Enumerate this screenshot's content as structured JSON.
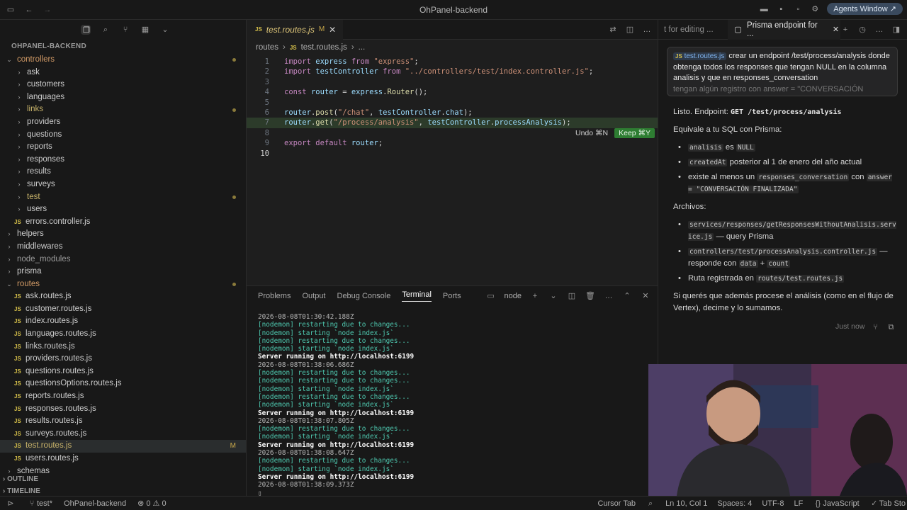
{
  "window": {
    "title": "OhPanel-backend",
    "agents_button": "Agents Window ↗"
  },
  "sidebar": {
    "explorer_title": "OHPANEL-BACKEND",
    "tree": [
      {
        "label": "controllers",
        "type": "folder",
        "open": true,
        "indent": 1,
        "color": "orange",
        "dot": true
      },
      {
        "label": "ask",
        "type": "folder",
        "indent": 2
      },
      {
        "label": "customers",
        "type": "folder",
        "indent": 2
      },
      {
        "label": "languages",
        "type": "folder",
        "indent": 2
      },
      {
        "label": "links",
        "type": "folder",
        "indent": 2,
        "color": "yellowish",
        "dot": true
      },
      {
        "label": "providers",
        "type": "folder",
        "indent": 2
      },
      {
        "label": "questions",
        "type": "folder",
        "indent": 2
      },
      {
        "label": "reports",
        "type": "folder",
        "indent": 2
      },
      {
        "label": "responses",
        "type": "folder",
        "indent": 2
      },
      {
        "label": "results",
        "type": "folder",
        "indent": 2
      },
      {
        "label": "surveys",
        "type": "folder",
        "indent": 2
      },
      {
        "label": "test",
        "type": "folder",
        "indent": 2,
        "color": "yellowish",
        "dot": true
      },
      {
        "label": "users",
        "type": "folder",
        "indent": 2
      },
      {
        "label": "errors.controller.js",
        "type": "file",
        "indent": 2
      },
      {
        "label": "helpers",
        "type": "folder",
        "indent": 1
      },
      {
        "label": "middlewares",
        "type": "folder",
        "indent": 1
      },
      {
        "label": "node_modules",
        "type": "folder",
        "indent": 1,
        "color": "dim"
      },
      {
        "label": "prisma",
        "type": "folder",
        "indent": 1
      },
      {
        "label": "routes",
        "type": "folder",
        "open": true,
        "indent": 1,
        "color": "orange",
        "dot": true
      },
      {
        "label": "ask.routes.js",
        "type": "file",
        "indent": 2
      },
      {
        "label": "customer.routes.js",
        "type": "file",
        "indent": 2
      },
      {
        "label": "index.routes.js",
        "type": "file",
        "indent": 2
      },
      {
        "label": "languages.routes.js",
        "type": "file",
        "indent": 2
      },
      {
        "label": "links.routes.js",
        "type": "file",
        "indent": 2
      },
      {
        "label": "providers.routes.js",
        "type": "file",
        "indent": 2
      },
      {
        "label": "questions.routes.js",
        "type": "file",
        "indent": 2
      },
      {
        "label": "questionsOptions.routes.js",
        "type": "file",
        "indent": 2
      },
      {
        "label": "reports.routes.js",
        "type": "file",
        "indent": 2
      },
      {
        "label": "responses.routes.js",
        "type": "file",
        "indent": 2
      },
      {
        "label": "results.routes.js",
        "type": "file",
        "indent": 2
      },
      {
        "label": "surveys.routes.js",
        "type": "file",
        "indent": 2
      },
      {
        "label": "test.routes.js",
        "type": "file",
        "indent": 2,
        "color": "yellowish",
        "selected": true,
        "mod": "M"
      },
      {
        "label": "users.routes.js",
        "type": "file",
        "indent": 2
      },
      {
        "label": "schemas",
        "type": "folder",
        "indent": 1
      }
    ],
    "outline_label": "OUTLINE",
    "timeline_label": "TIMELINE"
  },
  "editor": {
    "tab_label": "test.routes.js",
    "tab_modified": "M",
    "breadcrumb": [
      "routes",
      "test.routes.js",
      "..."
    ],
    "lines": [
      {
        "n": "1",
        "html": "<span class=\"kw\">import</span> <span class=\"id\">express</span> <span class=\"kw\">from</span> <span class=\"str\">\"express\"</span>;"
      },
      {
        "n": "2",
        "html": "<span class=\"kw\">import</span> <span class=\"id\">testController</span> <span class=\"kw\">from</span> <span class=\"str\">\"../controllers/test/index.controller.js\"</span>;"
      },
      {
        "n": "3",
        "html": ""
      },
      {
        "n": "4",
        "html": "<span class=\"kw\">const</span> <span class=\"id\">router</span> = <span class=\"id\">express</span>.<span class=\"fn\">Router</span>();"
      },
      {
        "n": "5",
        "html": ""
      },
      {
        "n": "6",
        "html": "<span class=\"id\">router</span>.<span class=\"fn\">post</span>(<span class=\"str\">\"/chat\"</span>, <span class=\"id\">testController</span>.<span class=\"id\">chat</span>);"
      },
      {
        "n": "7",
        "html": "<span class=\"id\">router</span>.<span class=\"fn\">get</span>(<span class=\"str\">\"/process/analysis\"</span>, <span class=\"id\">testController</span>.<span class=\"id\">processAnalysis</span>);",
        "added": true
      },
      {
        "n": "8",
        "html": ""
      },
      {
        "n": "9",
        "html": "<span class=\"kw\">export</span> <span class=\"kw\">default</span> <span class=\"id\">router</span>;"
      },
      {
        "n": "10",
        "html": "",
        "current": true
      }
    ],
    "undo_label": "Undo ⌘N",
    "keep_label": "Keep ⌘Y"
  },
  "panel": {
    "tabs": [
      "Problems",
      "Output",
      "Debug Console",
      "Terminal",
      "Ports"
    ],
    "active_tab": "Terminal",
    "terminal_name": "node",
    "terminal_lines": [
      {
        "t": "ts",
        "text": "2026-08-08T01:30:42.188Z"
      },
      {
        "t": "g",
        "text": "[nodemon] restarting due to changes..."
      },
      {
        "t": "g",
        "text": "[nodemon] starting `node index.js`"
      },
      {
        "t": "g",
        "text": "[nodemon] restarting due to changes..."
      },
      {
        "t": "g",
        "text": "[nodemon] starting `node index.js`"
      },
      {
        "t": "w",
        "text": "Server running on http://localhost:6199"
      },
      {
        "t": "ts",
        "text": "2026-08-08T01:38:06.686Z"
      },
      {
        "t": "g",
        "text": "[nodemon] restarting due to changes..."
      },
      {
        "t": "g",
        "text": "[nodemon] restarting due to changes..."
      },
      {
        "t": "g",
        "text": "[nodemon] starting `node index.js`"
      },
      {
        "t": "g",
        "text": "[nodemon] restarting due to changes..."
      },
      {
        "t": "g",
        "text": "[nodemon] starting `node index.js`"
      },
      {
        "t": "w",
        "text": "Server running on http://localhost:6199"
      },
      {
        "t": "ts",
        "text": "2026-08-08T01:38:07.805Z"
      },
      {
        "t": "g",
        "text": "[nodemon] restarting due to changes..."
      },
      {
        "t": "g",
        "text": "[nodemon] starting `node index.js`"
      },
      {
        "t": "w",
        "text": "Server running on http://localhost:6199"
      },
      {
        "t": "ts",
        "text": "2026-08-08T01:38:08.647Z"
      },
      {
        "t": "g",
        "text": "[nodemon] restarting due to changes..."
      },
      {
        "t": "g",
        "text": "[nodemon] starting `node index.js`"
      },
      {
        "t": "w",
        "text": "Server running on http://localhost:6199"
      },
      {
        "t": "ts",
        "text": "2026-08-08T01:38:09.373Z"
      },
      {
        "t": "ts",
        "text": "▯"
      }
    ]
  },
  "chat": {
    "prev_tab": "t for editing ...",
    "active_tab": "Prisma endpoint for ...",
    "prompt_chip": "test.routes.js",
    "prompt_text": " crear un endpoint  /test/process/analysis donde obtenga todos los responses que tengan NULL en la columna analisis y que en responses_conversation",
    "prompt_fade": "tengan algún registro con answer = \"CONVERSACIÓN",
    "reply_intro": "Listo. Endpoint: ",
    "reply_endpoint": "GET /test/process/analysis",
    "equiv": "Equivale a tu SQL con Prisma:",
    "b1_code": "analisis",
    "b1_mid": " es ",
    "b1_code2": "NULL",
    "b2_code": "createdAt",
    "b2_text": " posterior al 1 de enero del año actual",
    "b3_text": "existe al menos un ",
    "b3_code": "responses_conversation",
    "b3_mid": " con ",
    "b3_code2": "answer = \"CONVERSACIÓN FINALIZADA\"",
    "files_title": "Archivos:",
    "f1_code": "services/responses/getResponsesWithoutAnalisis.service.js",
    "f1_text": " — query Prisma",
    "f2_code": "controllers/test/processAnalysis.controller.js",
    "f2_text": " — responde con ",
    "f2_code2": "data",
    "f2_plus": " + ",
    "f2_code3": "count",
    "f3_text": "Ruta registrada en ",
    "f3_code": "routes/test.routes.js",
    "closing": "Si querés que además procese el análisis (como en el flujo de Vertex), decime y lo sumamos.",
    "meta": "Just now"
  },
  "status": {
    "branch": "test*",
    "project": "OhPanel-backend",
    "errors": "⊗ 0 ⚠ 0",
    "cursor_tab": "Cursor Tab",
    "position": "Ln 10, Col 1",
    "spaces": "Spaces: 4",
    "encoding": "UTF-8",
    "eol": "LF",
    "language": "JavaScript",
    "tab_stop": "Tab Sto"
  }
}
